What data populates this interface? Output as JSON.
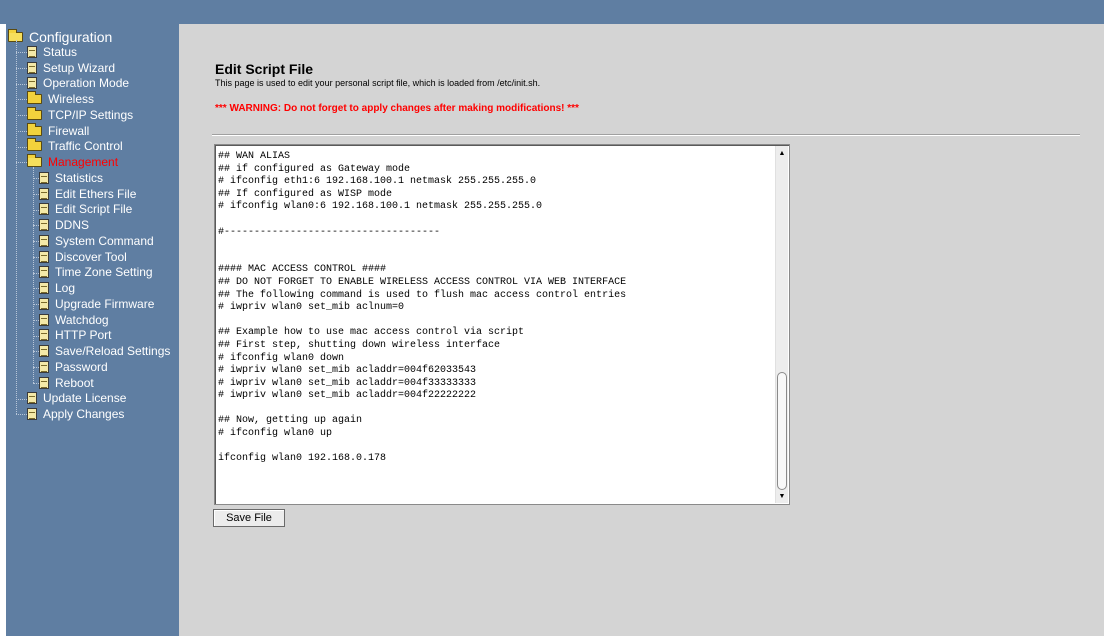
{
  "sidebar": {
    "root_label": "Configuration",
    "items": [
      {
        "label": "Status",
        "icon": "doc-icon",
        "level": 1,
        "active": false
      },
      {
        "label": "Setup Wizard",
        "icon": "doc-icon",
        "level": 1,
        "active": false
      },
      {
        "label": "Operation Mode",
        "icon": "doc-icon",
        "level": 1,
        "active": false
      },
      {
        "label": "Wireless",
        "icon": "folder-icon",
        "level": 1,
        "active": false
      },
      {
        "label": "TCP/IP Settings",
        "icon": "folder-icon",
        "level": 1,
        "active": false
      },
      {
        "label": "Firewall",
        "icon": "folder-icon",
        "level": 1,
        "active": false
      },
      {
        "label": "Traffic Control",
        "icon": "folder-icon",
        "level": 1,
        "active": false
      },
      {
        "label": "Management",
        "icon": "folder-open-icon",
        "level": 1,
        "active": true
      },
      {
        "label": "Statistics",
        "icon": "doc-icon",
        "level": 2,
        "active": false
      },
      {
        "label": "Edit Ethers File",
        "icon": "doc-icon",
        "level": 2,
        "active": false
      },
      {
        "label": "Edit Script File",
        "icon": "doc-icon",
        "level": 2,
        "active": false
      },
      {
        "label": "DDNS",
        "icon": "doc-icon",
        "level": 2,
        "active": false
      },
      {
        "label": "System Command",
        "icon": "doc-icon",
        "level": 2,
        "active": false
      },
      {
        "label": "Discover Tool",
        "icon": "doc-icon",
        "level": 2,
        "active": false
      },
      {
        "label": "Time Zone Setting",
        "icon": "doc-icon",
        "level": 2,
        "active": false
      },
      {
        "label": "Log",
        "icon": "doc-icon",
        "level": 2,
        "active": false
      },
      {
        "label": "Upgrade Firmware",
        "icon": "doc-icon",
        "level": 2,
        "active": false
      },
      {
        "label": "Watchdog",
        "icon": "doc-icon",
        "level": 2,
        "active": false
      },
      {
        "label": "HTTP Port",
        "icon": "doc-icon",
        "level": 2,
        "active": false
      },
      {
        "label": "Save/Reload Settings",
        "icon": "doc-icon",
        "level": 2,
        "active": false
      },
      {
        "label": "Password",
        "icon": "doc-icon",
        "level": 2,
        "active": false
      },
      {
        "label": "Reboot",
        "icon": "doc-icon",
        "level": 2,
        "active": false
      },
      {
        "label": "Update License",
        "icon": "doc-icon",
        "level": 1,
        "active": false
      },
      {
        "label": "Apply Changes",
        "icon": "doc-icon",
        "level": 1,
        "active": false
      }
    ]
  },
  "main": {
    "title": "Edit Script File",
    "description": "This page is used to edit your personal script file, which is loaded from /etc/init.sh.",
    "warning": "*** WARNING: Do not forget to apply changes after making modifications! ***",
    "script_text": "## WAN ALIAS\n## if configured as Gateway mode\n# ifconfig eth1:6 192.168.100.1 netmask 255.255.255.0\n## If configured as WISP mode\n# ifconfig wlan0:6 192.168.100.1 netmask 255.255.255.0\n\n#------------------------------------\n\n\n#### MAC ACCESS CONTROL ####\n## DO NOT FORGET TO ENABLE WIRELESS ACCESS CONTROL VIA WEB INTERFACE\n## The following command is used to flush mac access control entries\n# iwpriv wlan0 set_mib aclnum=0\n\n## Example how to use mac access control via script\n## First step, shutting down wireless interface\n# ifconfig wlan0 down\n# iwpriv wlan0 set_mib acladdr=004f62033543\n# iwpriv wlan0 set_mib acladdr=004f33333333\n# iwpriv wlan0 set_mib acladdr=004f22222222\n\n## Now, getting up again\n# ifconfig wlan0 up\n\nifconfig wlan0 192.168.0.178",
    "save_button": "Save File"
  },
  "colors": {
    "sidebar_bg": "#5f7ea2",
    "content_bg": "#d4d4d4",
    "active_item": "#ff0000",
    "warning": "#ff0000"
  }
}
